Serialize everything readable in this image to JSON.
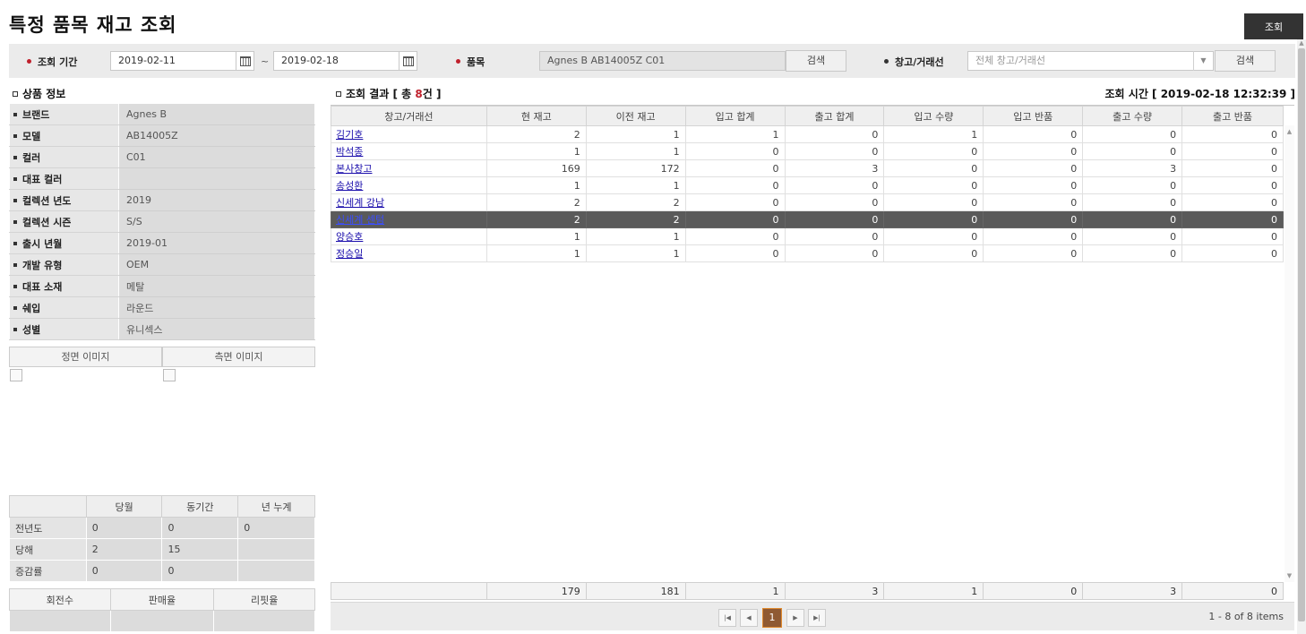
{
  "page": {
    "title": "특정 품목 재고 조회",
    "search_button": "조회"
  },
  "filters": {
    "period_label": "조회 기간",
    "date_from": "2019-02-11",
    "date_to": "2019-02-18",
    "tilde": "~",
    "item_label": "품목",
    "item_value": "Agnes B AB14005Z C01",
    "item_search": "검색",
    "store_label": "창고/거래선",
    "store_placeholder": "전체 창고/거래선",
    "store_search": "검색"
  },
  "product_info": {
    "heading": "상품 정보",
    "rows": [
      {
        "label": "브랜드",
        "value": "Agnes B"
      },
      {
        "label": "모델",
        "value": "AB14005Z"
      },
      {
        "label": "컬러",
        "value": "C01"
      },
      {
        "label": "대표 컬러",
        "value": ""
      },
      {
        "label": "컬렉션 년도",
        "value": "2019"
      },
      {
        "label": "컬렉션 시즌",
        "value": "S/S"
      },
      {
        "label": "출시 년월",
        "value": "2019-01"
      },
      {
        "label": "개발 유형",
        "value": "OEM"
      },
      {
        "label": "대표 소재",
        "value": "메탈"
      },
      {
        "label": "쉐입",
        "value": "라운드"
      },
      {
        "label": "성별",
        "value": "유니섹스"
      }
    ]
  },
  "images": {
    "front_tab": "정면 이미지",
    "side_tab": "측면 이미지"
  },
  "stats": {
    "headers": [
      "",
      "당월",
      "동기간",
      "년 누계"
    ],
    "rows": [
      {
        "label": "전년도",
        "values": [
          "0",
          "0",
          "0"
        ]
      },
      {
        "label": "당해",
        "values": [
          "2",
          "15",
          ""
        ]
      },
      {
        "label": "증감률",
        "values": [
          "0",
          "0",
          ""
        ]
      }
    ]
  },
  "rates": {
    "headers": [
      "회전수",
      "판매율",
      "리핏율"
    ],
    "values": [
      "",
      "",
      ""
    ]
  },
  "results": {
    "heading_prefix": "조회 결과 [ 총 ",
    "count": "8",
    "heading_suffix": "건 ]",
    "time_text": "조회 시간 [ 2019-02-18 12:32:39 ]",
    "columns": [
      "창고/거래선",
      "현 재고",
      "이전 재고",
      "입고 합계",
      "출고 합계",
      "입고 수량",
      "입고 반품",
      "출고 수량",
      "출고 반품"
    ],
    "rows": [
      {
        "name": "김기호",
        "values": [
          "2",
          "1",
          "1",
          "0",
          "1",
          "0",
          "0",
          "0"
        ]
      },
      {
        "name": "박석종",
        "values": [
          "1",
          "1",
          "0",
          "0",
          "0",
          "0",
          "0",
          "0"
        ]
      },
      {
        "name": "본사창고",
        "values": [
          "169",
          "172",
          "0",
          "3",
          "0",
          "0",
          "3",
          "0"
        ]
      },
      {
        "name": "송성환",
        "values": [
          "1",
          "1",
          "0",
          "0",
          "0",
          "0",
          "0",
          "0"
        ]
      },
      {
        "name": "신세계 강남",
        "values": [
          "2",
          "2",
          "0",
          "0",
          "0",
          "0",
          "0",
          "0"
        ]
      },
      {
        "name": "신세계 센텀",
        "values": [
          "2",
          "2",
          "0",
          "0",
          "0",
          "0",
          "0",
          "0"
        ],
        "selected": true
      },
      {
        "name": "양승호",
        "values": [
          "1",
          "1",
          "0",
          "0",
          "0",
          "0",
          "0",
          "0"
        ]
      },
      {
        "name": "정승일",
        "values": [
          "1",
          "1",
          "0",
          "0",
          "0",
          "0",
          "0",
          "0"
        ]
      }
    ],
    "totals": [
      "",
      "179",
      "181",
      "1",
      "3",
      "1",
      "0",
      "3",
      "0"
    ]
  },
  "pager": {
    "current_page": "1",
    "items_info": "1 - 8 of 8 items"
  },
  "colors": {
    "accent_dot": "#c0202c",
    "selected_row": "#5a5a5a",
    "current_page_border": "#e08a2e"
  }
}
